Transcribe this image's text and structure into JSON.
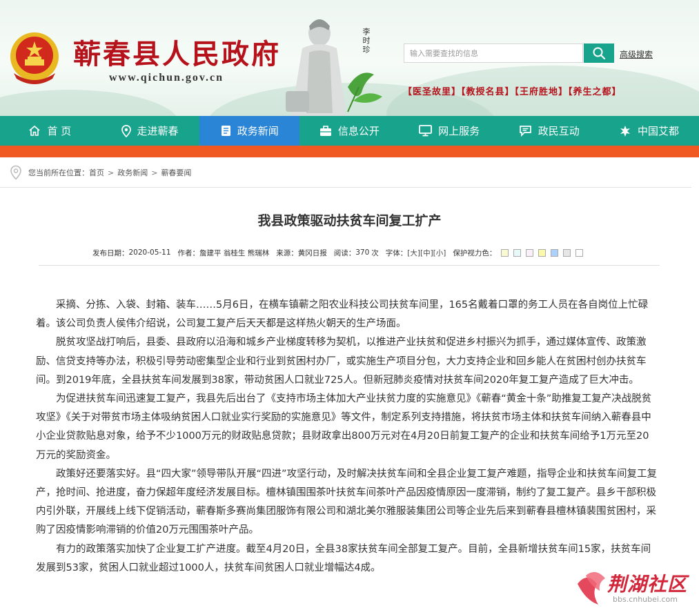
{
  "header": {
    "site_title": "蕲春县人民政府",
    "site_url": "www.qichun.gov.cn",
    "statue_caption": "李时珍",
    "search_placeholder": "输入需要查找的信息",
    "advanced_search": "高级搜索",
    "taglines": "【医圣故里】【教授名县】【王府胜地】【养生之都】"
  },
  "nav": {
    "items": [
      {
        "label": "首 页",
        "icon": "home-icon"
      },
      {
        "label": "走进蕲春",
        "icon": "location-pin-icon"
      },
      {
        "label": "政务新闻",
        "icon": "document-icon"
      },
      {
        "label": "信息公开",
        "icon": "briefcase-icon"
      },
      {
        "label": "网上服务",
        "icon": "monitor-icon"
      },
      {
        "label": "政民互动",
        "icon": "chat-icon"
      },
      {
        "label": "中国艾都",
        "icon": "leaf-icon"
      }
    ],
    "active_index": 2
  },
  "breadcrumb": {
    "prefix": "您当前所在位置：",
    "items": [
      "首页",
      "政务新闻",
      "蕲春要闻"
    ],
    "separator": ">"
  },
  "article": {
    "title": "我县政策驱动扶贫车间复工扩产",
    "meta": {
      "date_label": "发布日期：",
      "date": "2020-05-11",
      "author_label": "作者：",
      "author": "詹建平 翁桂生 熊瑞林",
      "source_label": "来源：",
      "source": "黄冈日报",
      "reads_label": "阅读：",
      "reads": "370",
      "reads_unit": "次",
      "font_label": "字体：",
      "font_sizes": [
        "[大]",
        "[中]",
        "[小]"
      ],
      "eye_label": "保护视力色："
    },
    "eye_colors": [
      "#fafad2",
      "#e6fafa",
      "#faf0fa",
      "#fafaaa",
      "#aad2fa",
      "#e6e6e6",
      "#ffffff"
    ],
    "paragraphs": [
      "采摘、分拣、入袋、封箱、装车……5月6日，在横车镇蕲之阳农业科技公司扶贫车间里，165名戴着口罩的务工人员在各自岗位上忙碌着。该公司负责人侯伟介绍说，公司复工复产后天天都是这样热火朝天的生产场面。",
      "脱贫攻坚战打响后，县委、县政府以沿海和城乡产业梯度转移为契机，以推进产业扶贫和促进乡村振兴为抓手，通过媒体宣传、政策激励、信贷支持等办法，积极引导劳动密集型企业和行业到贫困村办厂，或实施生产项目分包，大力支持企业和回乡能人在贫困村创办扶贫车间。到2019年底，全县扶贫车间发展到38家，带动贫困人口就业725人。但新冠肺炎疫情对扶贫车间2020年复工复产造成了巨大冲击。",
      "为促进扶贫车间迅速复工复产，我县先后出台了《支持市场主体加大产业扶贫力度的实施意见》《蕲春“黄金十条”助推复工复产决战脱贫攻坚》《关于对带贫市场主体吸纳贫困人口就业实行奖励的实施意见》等文件，制定系列支持措施，将扶贫市场主体和扶贫车间纳入蕲春县中小企业贷款贴息对象，给予不少1000万元的财政贴息贷款；县财政拿出800万元对在4月20日前复工复产的企业和扶贫车间给予1万元至20万元的奖励资金。",
      "政策好还要落实好。县“四大家”领导带队开展“四进”攻坚行动，及时解决扶贫车间和全县企业复工复产难题，指导企业和扶贫车间复工复产，抢时间、抢进度，奋力保超年度经济发展目标。檀林镇围围茶叶扶贫车间茶叶产品因疫情原因一度滞销，制约了复工复产。县乡干部积极内引外联，开展线上线下促销活动，蕲春斯多赛尚集团服饰有限公司和湖北美尔雅服装集团公司等企业先后来到蕲春县檀林镇裴围贫困村，采购了因疫情影响滞销的价值20万元围围茶叶产品。",
      "有力的政策落实加快了企业复工扩产进度。截至4月20日，全县38家扶贫车间全部复工复产。目前，全县新增扶贫车间15家，扶贫车间发展到53家，贫困人口就业超过1000人，扶贫车间贫困人口就业增幅达4成。"
    ]
  },
  "watermark": {
    "text": "荆湖社区",
    "url": "bbs.cnhubei.com"
  }
}
